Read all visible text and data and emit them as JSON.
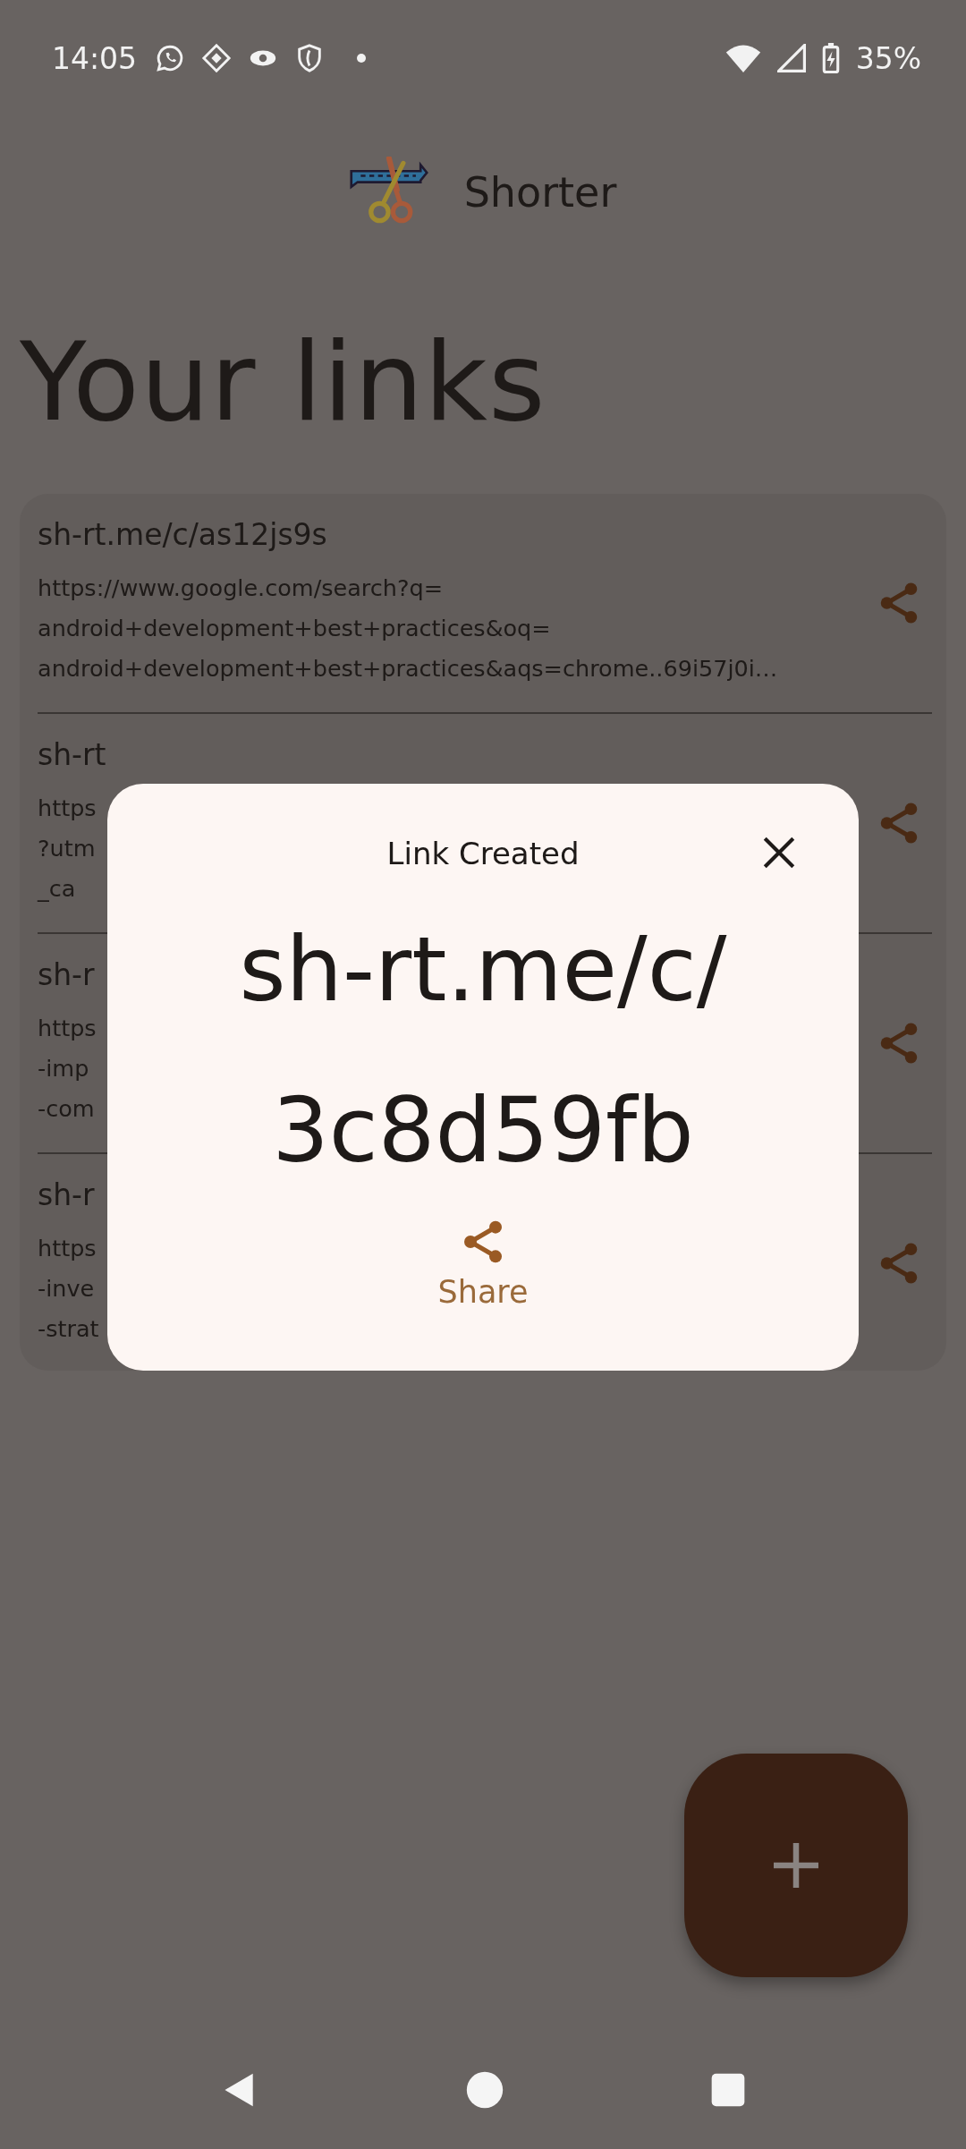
{
  "status_bar": {
    "time": "14:05",
    "battery": "35%"
  },
  "app_bar": {
    "title": "Shorter"
  },
  "heading": "Your links",
  "links": [
    {
      "short": "sh-rt.me/c/as12js9s",
      "url_lines": [
        "https://www.google.com/search?q=",
        "android+development+best+practices&oq=",
        "android+development+best+practices&aqs=chrome..69i57j0i…"
      ]
    },
    {
      "short": "sh-rt",
      "url_lines": [
        "https",
        "?utm",
        "_ca"
      ]
    },
    {
      "short": "sh-r",
      "url_lines": [
        "https",
        "-imp",
        "-com"
      ]
    },
    {
      "short": "sh-r",
      "url_lines": [
        "https",
        "-inve",
        "-strat"
      ]
    }
  ],
  "dialog": {
    "title": "Link Created",
    "link_lines": [
      "sh-rt.me/c/",
      "3c8d59fb"
    ],
    "share_label": "Share"
  }
}
